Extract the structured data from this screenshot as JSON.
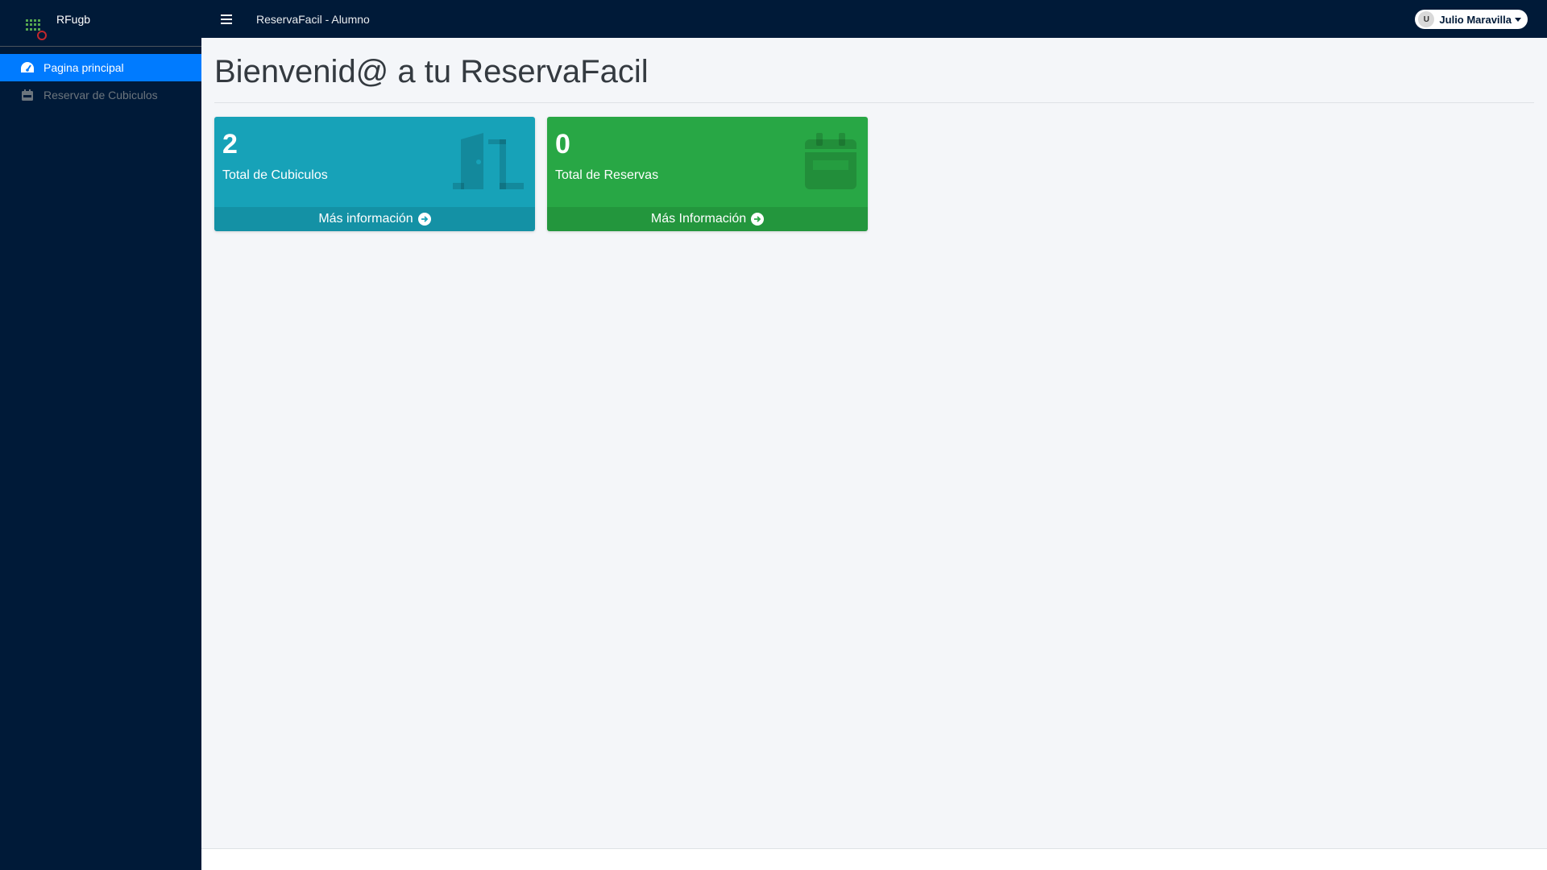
{
  "brand": {
    "name": "RFugb"
  },
  "sidebar": {
    "items": [
      {
        "label": "Pagina principal",
        "icon": "tachometer-icon",
        "active": true
      },
      {
        "label": "Reservar de Cubiculos",
        "icon": "calendar-icon",
        "active": false
      }
    ]
  },
  "topbar": {
    "title": "ReservaFacil - Alumno",
    "user": {
      "name": "Julio Maravilla",
      "avatar_alt": "U"
    }
  },
  "main": {
    "title": "Bienvenid@ a tu ReservaFacil",
    "cards": [
      {
        "value": "2",
        "label": "Total de Cubiculos",
        "link": "Más información",
        "icon": "door-icon",
        "color": "#17a2b8"
      },
      {
        "value": "0",
        "label": "Total de Reservas",
        "link": "Más Información",
        "icon": "calendar-icon",
        "color": "#28a745"
      }
    ]
  },
  "colors": {
    "sidebar_bg": "#001a38",
    "active_item": "#007bff",
    "content_bg": "#f4f6f9"
  }
}
